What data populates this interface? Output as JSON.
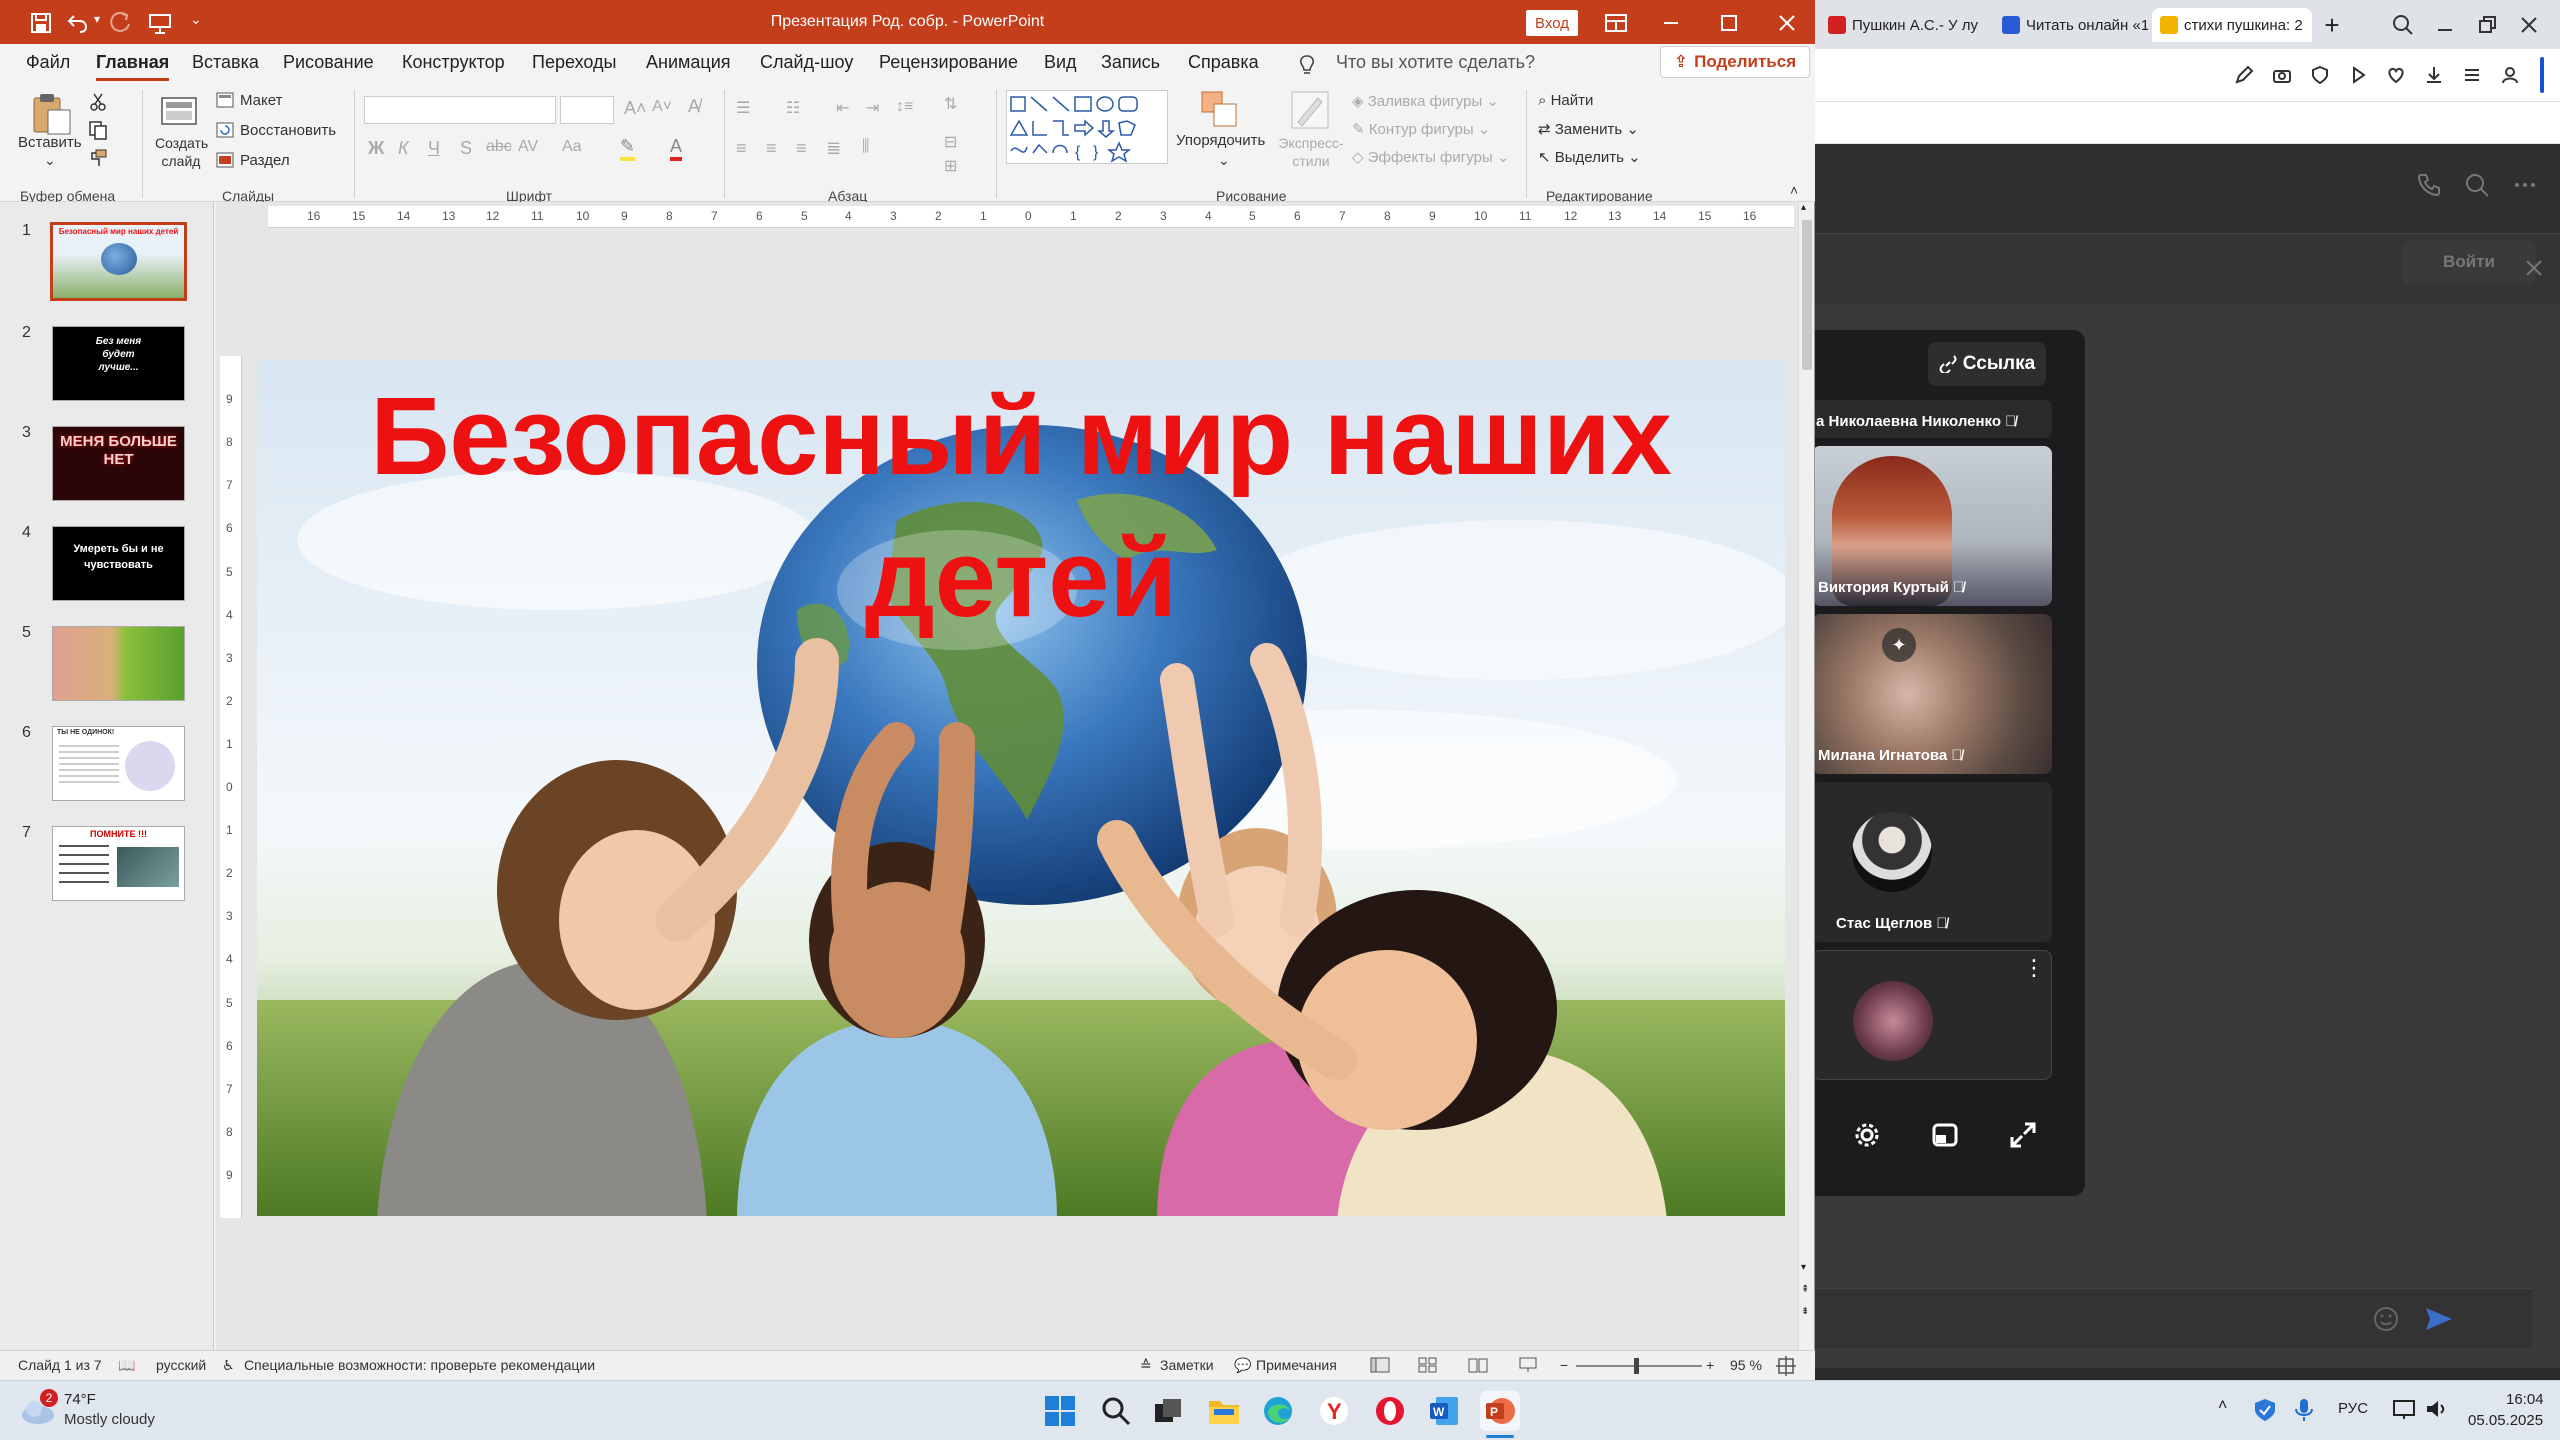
{
  "ppt": {
    "title": "Презентация Род. собр.  -  PowerPoint",
    "login": "Вход",
    "menu": [
      "Файл",
      "Главная",
      "Вставка",
      "Рисование",
      "Конструктор",
      "Переходы",
      "Анимация",
      "Слайд-шоу",
      "Рецензирование",
      "Вид",
      "Запись",
      "Справка"
    ],
    "search_placeholder": "Что вы хотите сделать?",
    "share": "Поделиться",
    "ribbon": {
      "paste": "Вставить",
      "new_slide": "Создать слайд",
      "layout": "Макет",
      "reset": "Восстановить",
      "section": "Раздел",
      "arrange": "Упорядочить",
      "quick_styles": "Экспресс-стили",
      "fill": "Заливка фигуры",
      "outline": "Контур фигуры",
      "effects": "Эффекты фигуры",
      "find": "Найти",
      "replace": "Заменить",
      "select": "Выделить",
      "groups": {
        "clipboard": "Буфер обмена",
        "slides": "Слайды",
        "font": "Шрифт",
        "paragraph": "Абзац",
        "drawing": "Рисование",
        "editing": "Редактирование"
      }
    },
    "thumbnails": [
      {
        "num": "1",
        "text": "Безопасный мир наших детей"
      },
      {
        "num": "2",
        "text": "Без меня будет лучше..."
      },
      {
        "num": "3",
        "text": "МЕНЯ БОЛЬШЕ НЕТ"
      },
      {
        "num": "4",
        "text": "Умереть бы и не чувствовать"
      },
      {
        "num": "5",
        "text": ""
      },
      {
        "num": "6",
        "text": "ТЫ НЕ ОДИНОК!"
      },
      {
        "num": "7",
        "text": "ПОМНИТЕ !!!"
      }
    ],
    "slide_title": "Безопасный мир наших детей",
    "status": {
      "slide_info": "Слайд 1 из 7",
      "language": "русский",
      "accessibility": "Специальные возможности: проверьте рекомендации",
      "notes": "Заметки",
      "comments": "Примечания",
      "zoom": "95 %"
    },
    "ruler_h": [
      "16",
      "15",
      "14",
      "13",
      "12",
      "11",
      "10",
      "9",
      "8",
      "7",
      "6",
      "5",
      "4",
      "3",
      "2",
      "1",
      "0",
      "1",
      "2",
      "3",
      "4",
      "5",
      "6",
      "7",
      "8",
      "9",
      "10",
      "11",
      "12",
      "13",
      "14",
      "15",
      "16"
    ],
    "ruler_v": [
      "9",
      "8",
      "7",
      "6",
      "5",
      "4",
      "3",
      "2",
      "1",
      "0",
      "1",
      "2",
      "3",
      "4",
      "5",
      "6",
      "7",
      "8",
      "9"
    ]
  },
  "browser": {
    "tabs": [
      {
        "label": "Пушкин А.С.- У лу",
        "color": "#d21f1f"
      },
      {
        "label": "Читать онлайн «1",
        "color": "#2a5bd7"
      },
      {
        "label": "стихи пушкина: 2",
        "color": "#f2b400"
      }
    ],
    "join": "Войти",
    "link_btn": "Ссылка",
    "participants": [
      {
        "name": "а Николаевна Николенко"
      },
      {
        "name": "Виктория Куртый"
      },
      {
        "name": "Милана Игнатова"
      },
      {
        "name": "Стас Щеглов"
      },
      {
        "name": ""
      }
    ]
  },
  "taskbar": {
    "weather_temp": "74°F",
    "weather_desc": "Mostly cloudy",
    "weather_badge": "2",
    "lang": "РУС",
    "time": "16:04",
    "date": "05.05.2025"
  },
  "colors": {
    "ppt_accent": "#c43e1c",
    "slide_title": "#ee1111"
  }
}
